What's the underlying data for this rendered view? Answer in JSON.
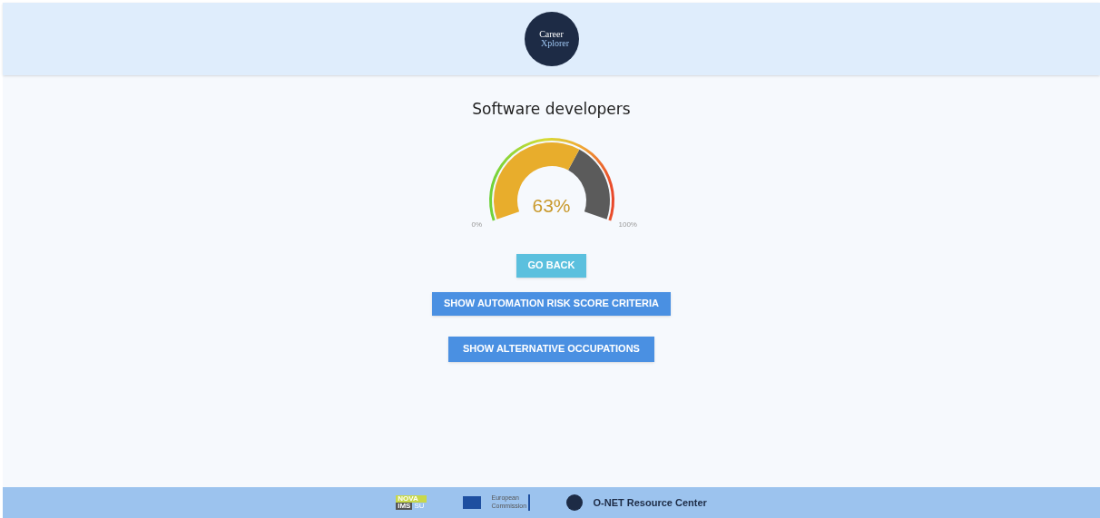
{
  "header": {
    "logo_text": [
      "Career",
      "Xplorer"
    ]
  },
  "title": "Software developers",
  "gauge": {
    "level": 0.63,
    "value_label": "63%",
    "min_label": "0%",
    "max_label": "100%"
  },
  "buttons": [
    {
      "label": "GO BACK",
      "kind": "info"
    },
    {
      "label": "SHOW AUTOMATION RISK SCORE CRITERIA",
      "kind": "primary"
    },
    {
      "label": "SHOW ALTERNATIVE OCCUPATIONS",
      "kind": "primary"
    }
  ],
  "footer": {
    "nova": [
      "NOVA",
      "IMS",
      "SU"
    ],
    "eu": "European Commission",
    "onet": "O-NET Resource Center"
  }
}
